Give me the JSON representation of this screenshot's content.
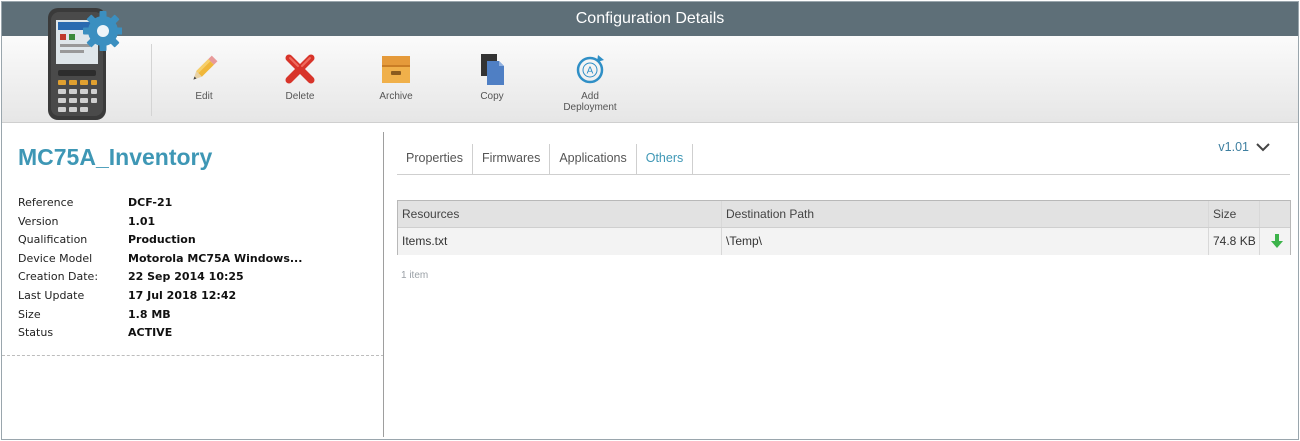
{
  "window": {
    "title": "Configuration Details"
  },
  "toolbar": {
    "buttons": [
      {
        "id": "edit",
        "label": "Edit"
      },
      {
        "id": "delete",
        "label": "Delete"
      },
      {
        "id": "archive",
        "label": "Archive"
      },
      {
        "id": "copy",
        "label": "Copy"
      },
      {
        "id": "add_deployment",
        "label": "Add Deployment"
      }
    ]
  },
  "icons": {
    "device": "handheld-scanner-icon",
    "gear": "gear-icon",
    "edit": "pencil-icon",
    "delete": "red-x-icon",
    "archive": "box-icon",
    "copy": "copy-icon",
    "add_deployment": "deployment-icon",
    "download": "download-arrow-icon"
  },
  "colors": {
    "titlebar": "#5e6f78",
    "accent": "#3e97b5",
    "download_green": "#3cb34a",
    "delete_red": "#d8342a"
  },
  "config": {
    "name": "MC75A_Inventory",
    "properties": [
      {
        "key": "Reference",
        "value": "DCF-21"
      },
      {
        "key": "Version",
        "value": "1.01"
      },
      {
        "key": "Qualification",
        "value": "Production"
      },
      {
        "key": "Device Model",
        "value": "Motorola MC75A Windows..."
      },
      {
        "key": "Creation Date:",
        "value": "22 Sep 2014 10:25"
      },
      {
        "key": "Last Update",
        "value": "17 Jul 2018 12:42"
      },
      {
        "key": "Size",
        "value": "1.8 MB"
      },
      {
        "key": "Status",
        "value": "ACTIVE"
      }
    ]
  },
  "tabs": [
    {
      "label": "Properties",
      "active": false
    },
    {
      "label": "Firmwares",
      "active": false
    },
    {
      "label": "Applications",
      "active": false
    },
    {
      "label": "Others",
      "active": true
    }
  ],
  "version_selector": {
    "label": "v1.01"
  },
  "resources_table": {
    "columns": [
      "Resources",
      "Destination Path",
      "Size"
    ],
    "rows": [
      {
        "resource": "Items.txt",
        "path": "\\Temp\\",
        "size": "74.8 KB"
      }
    ],
    "count_label": "1 item"
  }
}
